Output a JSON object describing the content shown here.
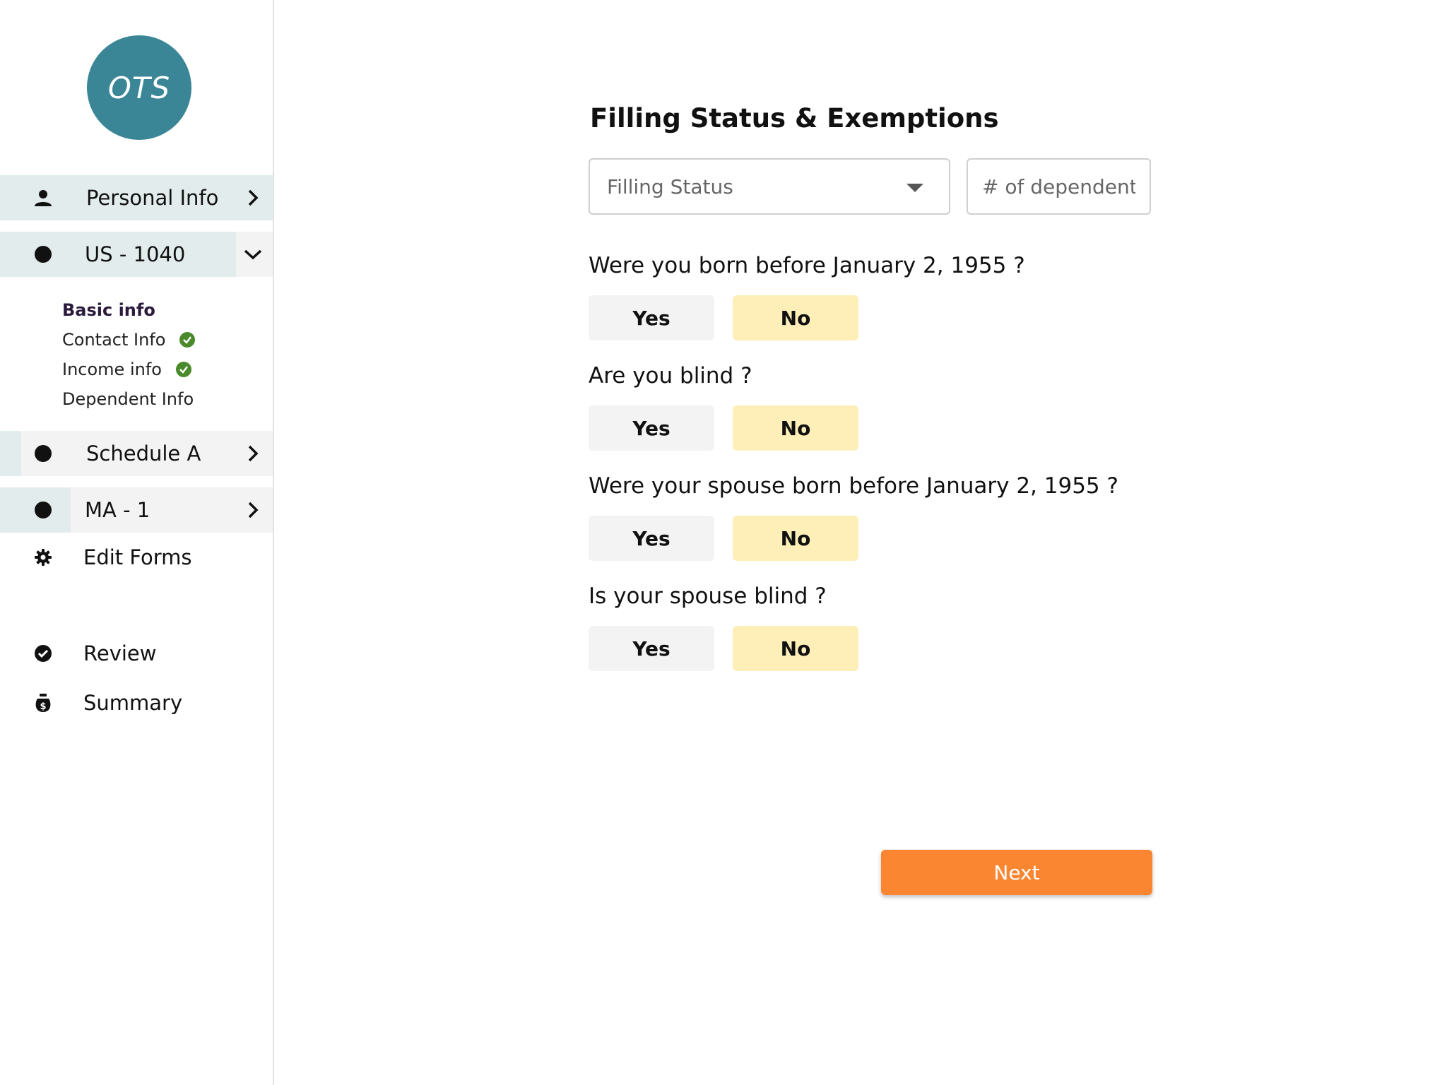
{
  "sidebar": {
    "logo_text": "OTS",
    "nav": {
      "personal_info": "Personal Info",
      "us1040": "US - 1040",
      "schedule_a": "Schedule A",
      "ma1": "MA - 1",
      "edit_forms": "Edit Forms",
      "review": "Review",
      "summary": "Summary"
    },
    "sub_items": [
      "Basic info",
      "Contact Info",
      "Income info",
      "Dependent Info"
    ],
    "icons": {
      "personal_info": "person-icon",
      "section_bullet": "dot-icon",
      "edit_forms": "gear-icon",
      "review": "check-circle-icon",
      "summary": "money-bag-icon",
      "completed": "check-icon"
    }
  },
  "main": {
    "title": "Filling Status & Exemptions",
    "filing_status": {
      "placeholder": "Filling Status"
    },
    "dependents": {
      "placeholder": "# of dependents"
    },
    "questions": [
      {
        "text": "Were you born before January 2, 1955 ?",
        "yes": "Yes",
        "no": "No",
        "selected": "No"
      },
      {
        "text": "Are you blind ?",
        "yes": "Yes",
        "no": "No",
        "selected": "No"
      },
      {
        "text": "Were your spouse born before January 2, 1955 ?",
        "yes": "Yes",
        "no": "No",
        "selected": "No"
      },
      {
        "text": "Is your spouse blind ?",
        "yes": "Yes",
        "no": "No",
        "selected": "No"
      }
    ],
    "next_label": "Next"
  },
  "colors": {
    "logo": "#3b8696",
    "active_row": "#e3eced",
    "selected_answer": "#fdefb7",
    "unselected_answer": "#f3f3f3",
    "primary_button": "#fb8632",
    "check": "#4a8a2a"
  }
}
